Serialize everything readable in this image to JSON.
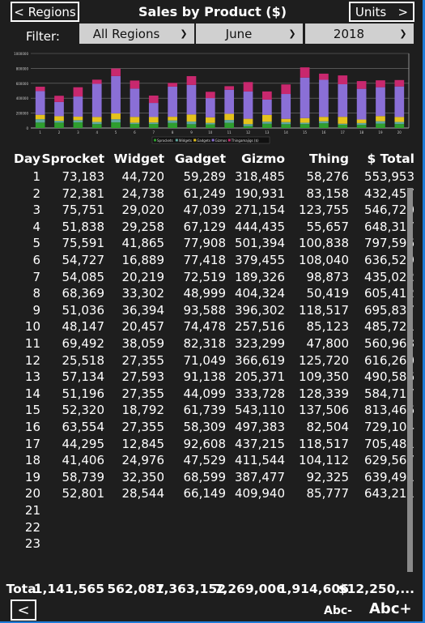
{
  "header": {
    "back_label": "< Regions",
    "title": "Sales by Product ($)",
    "next_label": "Units   >"
  },
  "filter": {
    "label": "Filter:",
    "region": "All Regions",
    "month": "June",
    "year": "2018"
  },
  "table": {
    "columns": [
      "Day",
      "Sprocket",
      "Widget",
      "Gadget",
      "Gizmo",
      "Thing",
      "$ Total"
    ],
    "rows": [
      [
        "1",
        "73,183",
        "44,720",
        "59,289",
        "318,485",
        "58,276",
        "553,953"
      ],
      [
        "2",
        "72,381",
        "24,738",
        "61,249",
        "190,931",
        "83,158",
        "432,457"
      ],
      [
        "3",
        "75,751",
        "29,020",
        "47,039",
        "271,154",
        "123,755",
        "546,720"
      ],
      [
        "4",
        "51,838",
        "29,258",
        "67,129",
        "444,435",
        "55,657",
        "648,317"
      ],
      [
        "5",
        "75,591",
        "41,865",
        "77,908",
        "501,394",
        "100,838",
        "797,596"
      ],
      [
        "6",
        "54,727",
        "16,889",
        "77,418",
        "379,455",
        "108,040",
        "636,529"
      ],
      [
        "7",
        "54,085",
        "20,219",
        "72,519",
        "189,326",
        "98,873",
        "435,022"
      ],
      [
        "8",
        "68,369",
        "33,302",
        "48,999",
        "404,324",
        "50,419",
        "605,412"
      ],
      [
        "9",
        "51,036",
        "36,394",
        "93,588",
        "396,302",
        "118,517",
        "695,837"
      ],
      [
        "10",
        "48,147",
        "20,457",
        "74,478",
        "257,516",
        "85,123",
        "485,721"
      ],
      [
        "11",
        "69,492",
        "38,059",
        "82,318",
        "323,299",
        "47,800",
        "560,968"
      ],
      [
        "12",
        "25,518",
        "27,355",
        "71,049",
        "366,619",
        "125,720",
        "616,260"
      ],
      [
        "13",
        "57,134",
        "27,593",
        "91,138",
        "205,371",
        "109,350",
        "490,586"
      ],
      [
        "14",
        "51,196",
        "27,355",
        "44,099",
        "333,728",
        "128,339",
        "584,717"
      ],
      [
        "15",
        "52,320",
        "18,792",
        "61,739",
        "543,110",
        "137,506",
        "813,466"
      ],
      [
        "16",
        "63,554",
        "27,355",
        "58,309",
        "497,383",
        "82,504",
        "729,104"
      ],
      [
        "17",
        "44,295",
        "12,845",
        "92,608",
        "437,215",
        "118,517",
        "705,481"
      ],
      [
        "18",
        "41,406",
        "24,976",
        "47,529",
        "411,544",
        "104,112",
        "629,567"
      ],
      [
        "19",
        "58,739",
        "32,350",
        "68,599",
        "387,477",
        "92,325",
        "639,491"
      ],
      [
        "20",
        "52,801",
        "28,544",
        "66,149",
        "409,940",
        "85,777",
        "643,211"
      ],
      [
        "21",
        "",
        "",
        "",
        "",
        "",
        ""
      ],
      [
        "22",
        "",
        "",
        "",
        "",
        "",
        ""
      ],
      [
        "23",
        "",
        "",
        "",
        "",
        "",
        ""
      ]
    ],
    "totals": [
      "Total",
      "1,141,565",
      "562,087",
      "1,363,152",
      "7,269,006",
      "1,914,606",
      "$12,250,..."
    ]
  },
  "footer": {
    "prev_label": "<",
    "font_smaller": "Abc-",
    "font_larger": "Abc+"
  },
  "chart_data": {
    "type": "bar",
    "stacked": true,
    "categories": [
      "1",
      "2",
      "3",
      "4",
      "5",
      "6",
      "7",
      "8",
      "9",
      "10",
      "11",
      "12",
      "13",
      "14",
      "15",
      "16",
      "17",
      "18",
      "19",
      "20"
    ],
    "ylim": [
      0,
      1000000
    ],
    "yticks": [
      "0",
      "200000",
      "400000",
      "600000",
      "800000",
      "1000000"
    ],
    "grid": true,
    "legend": "bottom",
    "series": [
      {
        "name": "Sprockets",
        "color": "#2e9e2e",
        "values": [
          73183,
          72381,
          75751,
          51838,
          75591,
          54727,
          54085,
          68369,
          51036,
          48147,
          69492,
          25518,
          57134,
          51196,
          52320,
          63554,
          44295,
          41406,
          58739,
          52801
        ]
      },
      {
        "name": "Widgets",
        "color": "#5fa8a0",
        "values": [
          44720,
          24738,
          29020,
          29258,
          41865,
          16889,
          20219,
          33302,
          36394,
          20457,
          38059,
          27355,
          27593,
          27355,
          18792,
          27355,
          12845,
          24976,
          32350,
          28544
        ]
      },
      {
        "name": "Gadgets",
        "color": "#e5c21c",
        "values": [
          59289,
          61249,
          47039,
          67129,
          77908,
          77418,
          72519,
          48999,
          93588,
          74478,
          82318,
          71049,
          91138,
          44099,
          61739,
          58309,
          92608,
          47529,
          68599,
          66149
        ]
      },
      {
        "name": "Gizmos",
        "color": "#8a6fd6",
        "values": [
          318485,
          190931,
          271154,
          444435,
          501394,
          379455,
          189326,
          404324,
          396302,
          257516,
          323299,
          366619,
          205371,
          333728,
          543110,
          497383,
          437215,
          411544,
          387477,
          409940
        ]
      },
      {
        "name": "Thingamajigs ($)",
        "color": "#c8286e",
        "values": [
          58276,
          83158,
          123755,
          55657,
          100838,
          108040,
          98873,
          50419,
          118517,
          85123,
          47800,
          125720,
          109350,
          128339,
          137506,
          82504,
          118517,
          104112,
          92325,
          85777
        ]
      }
    ]
  }
}
